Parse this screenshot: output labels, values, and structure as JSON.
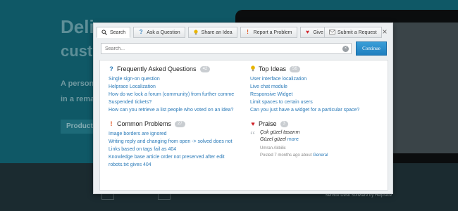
{
  "background": {
    "headline": "Deli",
    "headline2": "cust",
    "paragraph": [
      "A persona",
      "in a remar"
    ],
    "button": "Product",
    "footer_text": "Service Desk Software by Helprace"
  },
  "tabs": [
    {
      "label": "Search",
      "icon": "search-icon"
    },
    {
      "label": "Ask a Question",
      "icon": "question-icon"
    },
    {
      "label": "Share an Idea",
      "icon": "lightbulb-icon"
    },
    {
      "label": "Report a Problem",
      "icon": "exclamation-icon"
    },
    {
      "label": "Give Praise",
      "icon": "heart-icon"
    }
  ],
  "submit_request": {
    "label": "Submit a Request",
    "icon": "envelope-icon"
  },
  "search": {
    "placeholder": "Search...",
    "continue_label": "Continue"
  },
  "faq": {
    "title": "Frequently Asked Questions",
    "count": "42",
    "items": [
      "Single sign-on question",
      "Helprace Localization",
      "How do we lock a forum (community) from further comme",
      "Suspended tickets?",
      "How can you retrieve a list people who voted on an idea?"
    ]
  },
  "ideas": {
    "title": "Top Ideas",
    "count": "56",
    "items": [
      "User interface localization",
      "Live chat module",
      "Responsive Widget",
      "Limit spaces to certain users",
      "Can you just have a widget for a particular space?"
    ]
  },
  "problems": {
    "title": "Common Problems",
    "count": "27",
    "items": [
      "Image borders are ignored",
      "Writing reply and changing from open -> solved does not",
      "Links based on tags fail as 404",
      "Knowledge base article order not preserved after edit",
      "robots.txt gives 404"
    ]
  },
  "praise": {
    "title": "Praise",
    "count": "3",
    "quote_title": "Çok güzel tasarım",
    "quote_body": "Güzel güzel",
    "more_label": "more",
    "author": "Umran Akbilic",
    "posted": "Posted 7 months ago about",
    "category": "General"
  },
  "colors": {
    "link": "#2a7ab8",
    "continue": "#1f7fbf",
    "faq_icon": "#2a7ab8",
    "idea_icon": "#e8b400",
    "problem_icon": "#e0531f",
    "praise_icon": "#d0232b"
  }
}
